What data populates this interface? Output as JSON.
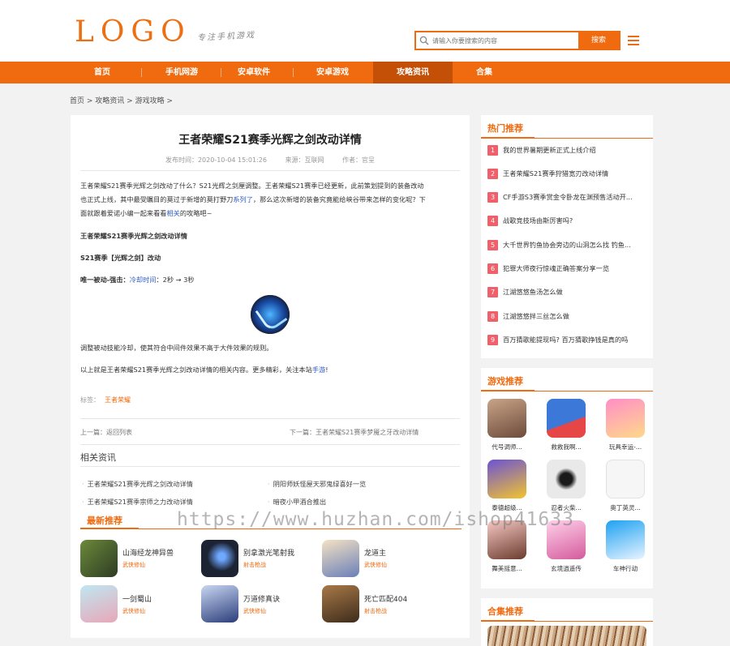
{
  "header": {
    "logo": "LOGO",
    "slogan": "专注手机游戏",
    "search_placeholder": "请输入你要搜索的内容",
    "search_button": "搜索"
  },
  "nav": {
    "items": [
      "首页",
      "手机网游",
      "安卓软件",
      "安卓游戏",
      "攻略资讯",
      "合集"
    ],
    "active_index": 4
  },
  "breadcrumb": [
    "首页 >",
    "攻略资讯 >",
    "游戏攻略 >"
  ],
  "article": {
    "title": "王者荣耀S21赛季光辉之剑改动详情",
    "time_label": "发布时间：2020-10-04 15:01:26",
    "source_label": "来源：互联网",
    "author_label": "作者：官呈",
    "intro_p1": "王者荣耀S21赛季光辉之剑改动了什么？S21光辉之剑厘调整。王者荣耀S21赛季已经更新，此前策划提到的装备改动",
    "intro_p2": "也正式上线，其中最受瞩目的莫过于新增的莫打野刀",
    "intro_link1": "系列了",
    "intro_p3": "，那么这次新增的装备究竟能给峡谷带来怎样的变化呢？下",
    "intro_p4": "面就跟着爱诺小编一起来看看",
    "intro_link2": "相关",
    "intro_p5": "的攻略吧~",
    "heading1": "王者荣耀S21赛季光辉之剑改动详情",
    "heading2": "S21赛季【光辉之剑】改动",
    "skill_label": "唯一被动-强击：",
    "skill_link": "冷却时间",
    "skill_value": "：2秒 → 3秒",
    "body1": "调整被动技能冷却，使其符合中间件效果不高于大件效果的规则。",
    "body2_pre": "以上就是王者荣耀S21赛季光辉之剑改动详情的相关内容。更多精彩，关注本站",
    "body2_link": "手游",
    "body2_post": "!",
    "tags_label": "标签：",
    "tag": "王者荣耀",
    "prev": "上一篇：返回列表",
    "next": "下一篇：王者荣耀S21赛季梦魇之牙改动详情"
  },
  "related": {
    "title": "相关资讯",
    "items": [
      "王者荣耀S21赛季光辉之剑改动详情",
      "阴阳师妖怪屋天邪鬼绿喜好一览",
      "王者荣耀S21赛季宗师之力改动详情",
      "暗夜小甲酒合推出"
    ]
  },
  "latest": {
    "title": "最新推荐",
    "games": [
      {
        "name": "山海经龙神异兽",
        "cat": "武侠修仙",
        "c1": "#6b8a3a",
        "c2": "#2e3b24"
      },
      {
        "name": "别拿激光笔射我",
        "cat": "射击枪战",
        "c1": "#1c2333",
        "c2": "#6ea8ff"
      },
      {
        "name": "龙道主",
        "cat": "武侠修仙",
        "c1": "#f4e2c4",
        "c2": "#6a7fb8"
      },
      {
        "name": "一剑蜀山",
        "cat": "武侠修仙",
        "c1": "#bfe7f2",
        "c2": "#e8a7b8"
      },
      {
        "name": "万道修真诀",
        "cat": "武侠修仙",
        "c1": "#2b3d7a",
        "c2": "#c9d6f2"
      },
      {
        "name": "死亡匹配404",
        "cat": "射击枪战",
        "c1": "#a87948",
        "c2": "#3d2c1b"
      }
    ]
  },
  "hot": {
    "title": "热门推荐",
    "items": [
      "我的世界暑期更新正式上线介绍",
      "王者荣耀S21赛季狩猎宽刃改动详情",
      "CF手游S3赛季赏金令卧龙在渊预售活动开...",
      "战歌竞技场由斯厉害吗?",
      "大千世界钓鱼协会旁边的山洞怎么找 钓鱼...",
      "犯罪大师夜行惊魂正确答案分享一览",
      "江湖悠悠鱼汤怎么做",
      "江湖悠悠拌三丝怎么做",
      "百万猜歌能提现吗? 百万猜歌挣钱是真的吗"
    ]
  },
  "game_rec": {
    "title": "游戏推荐",
    "games": [
      {
        "name": "代号调师...",
        "c1": "#c8a488",
        "c2": "#6d4a3a"
      },
      {
        "name": "救救我啊...",
        "c1": "#3b78d8",
        "c2": "#e74646"
      },
      {
        "name": "玩具幸运-...",
        "c1": "#ff8ec7",
        "c2": "#ffd98a"
      },
      {
        "name": "泰德超级...",
        "c1": "#6b52d6",
        "c2": "#f3c42e"
      },
      {
        "name": "忍者火柴...",
        "c1": "#e9e9e9",
        "c2": "#1a1a1a"
      },
      {
        "name": "奥丁英灵...",
        "c1": "#f6f6f6",
        "c2": "#cfcfcf"
      },
      {
        "name": "舞美摇意...",
        "c1": "#f7c9c5",
        "c2": "#6b3b2d"
      },
      {
        "name": "玄境逍遥传",
        "c1": "#ffd1ea",
        "c2": "#d45b9c"
      },
      {
        "name": "车神行动",
        "c1": "#1da1f2",
        "c2": "#e8f4ff"
      }
    ]
  },
  "collection": {
    "title": "合集推荐"
  },
  "watermark": "https://www.huzhan.com/ishop41633"
}
